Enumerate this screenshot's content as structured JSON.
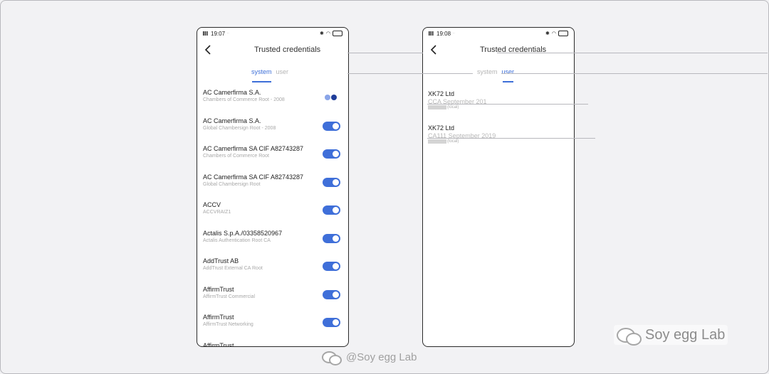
{
  "left_phone": {
    "status_time": "19:07",
    "title": "Trusted credentials",
    "tabs": [
      {
        "label": "system",
        "active": true
      },
      {
        "label": "user",
        "active": false
      }
    ],
    "items": [
      {
        "name": "AC Camerfirma S.A.",
        "sub": "Chambers of Commerce Root - 2008",
        "toggle": "loading"
      },
      {
        "name": "AC Camerfirma S.A.",
        "sub": "Global Chambersign Root - 2008",
        "toggle": "on"
      },
      {
        "name": "AC Camerfirma SA CIF A82743287",
        "sub": "Chambers of Commerce Root",
        "toggle": "on"
      },
      {
        "name": "AC Camerfirma SA CIF A82743287",
        "sub": "Global Chambersign Root",
        "toggle": "on"
      },
      {
        "name": "ACCV",
        "sub": "ACCVRAIZ1",
        "toggle": "on"
      },
      {
        "name": "Actalis S.p.A./03358520967",
        "sub": "Actalis Authentication Root CA",
        "toggle": "on"
      },
      {
        "name": "AddTrust AB",
        "sub": "AddTrust External CA Root",
        "toggle": "on"
      },
      {
        "name": "AffirmTrust",
        "sub": "AffirmTrust Commercial",
        "toggle": "on"
      },
      {
        "name": "AffirmTrust",
        "sub": "AffirmTrust Networking",
        "toggle": "on"
      },
      {
        "name": "AffirmTrust",
        "sub": "",
        "toggle": "on"
      }
    ]
  },
  "right_phone": {
    "status_time": "19:08",
    "title": "Trusted credentials",
    "tabs": [
      {
        "label": "system",
        "active": false
      },
      {
        "label": "user",
        "active": true
      }
    ],
    "items": [
      {
        "name": "XK72 Ltd",
        "cert": "CCA September 201",
        "loc": "(local)"
      },
      {
        "name": "XK72 Ltd",
        "cert": "CA111 September 2019",
        "loc": "(local)"
      }
    ]
  },
  "watermark": {
    "right_text": "Soy egg Lab",
    "bottom_text": "@Soy egg Lab"
  },
  "colors": {
    "accent": "#3f6fd9",
    "background": "#f2f2f4"
  }
}
